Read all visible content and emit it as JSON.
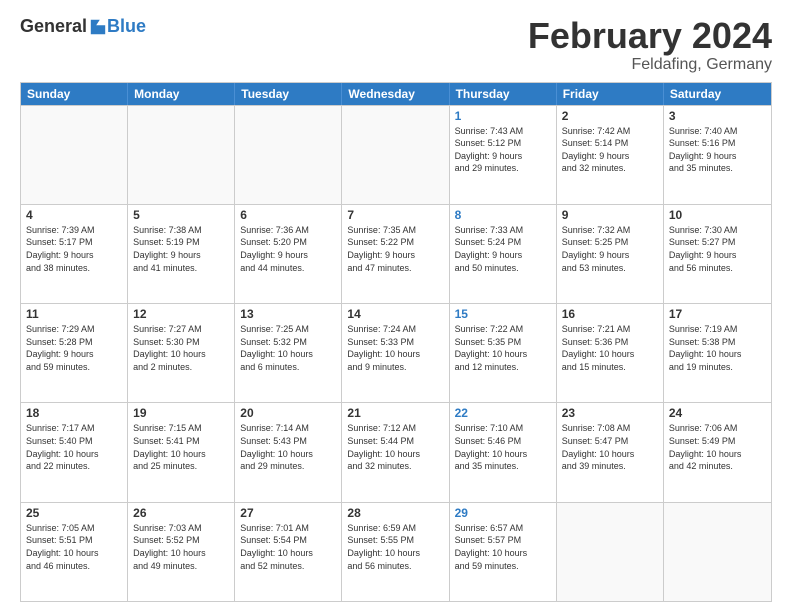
{
  "logo": {
    "general": "General",
    "blue": "Blue"
  },
  "title": "February 2024",
  "subtitle": "Feldafing, Germany",
  "days": [
    "Sunday",
    "Monday",
    "Tuesday",
    "Wednesday",
    "Thursday",
    "Friday",
    "Saturday"
  ],
  "rows": [
    [
      {
        "day": "",
        "empty": true
      },
      {
        "day": "",
        "empty": true
      },
      {
        "day": "",
        "empty": true
      },
      {
        "day": "",
        "empty": true
      },
      {
        "day": "1",
        "thursday": true,
        "info": "Sunrise: 7:43 AM\nSunset: 5:12 PM\nDaylight: 9 hours\nand 29 minutes."
      },
      {
        "day": "2",
        "info": "Sunrise: 7:42 AM\nSunset: 5:14 PM\nDaylight: 9 hours\nand 32 minutes."
      },
      {
        "day": "3",
        "info": "Sunrise: 7:40 AM\nSunset: 5:16 PM\nDaylight: 9 hours\nand 35 minutes."
      }
    ],
    [
      {
        "day": "4",
        "info": "Sunrise: 7:39 AM\nSunset: 5:17 PM\nDaylight: 9 hours\nand 38 minutes."
      },
      {
        "day": "5",
        "info": "Sunrise: 7:38 AM\nSunset: 5:19 PM\nDaylight: 9 hours\nand 41 minutes."
      },
      {
        "day": "6",
        "info": "Sunrise: 7:36 AM\nSunset: 5:20 PM\nDaylight: 9 hours\nand 44 minutes."
      },
      {
        "day": "7",
        "info": "Sunrise: 7:35 AM\nSunset: 5:22 PM\nDaylight: 9 hours\nand 47 minutes."
      },
      {
        "day": "8",
        "thursday": true,
        "info": "Sunrise: 7:33 AM\nSunset: 5:24 PM\nDaylight: 9 hours\nand 50 minutes."
      },
      {
        "day": "9",
        "info": "Sunrise: 7:32 AM\nSunset: 5:25 PM\nDaylight: 9 hours\nand 53 minutes."
      },
      {
        "day": "10",
        "info": "Sunrise: 7:30 AM\nSunset: 5:27 PM\nDaylight: 9 hours\nand 56 minutes."
      }
    ],
    [
      {
        "day": "11",
        "info": "Sunrise: 7:29 AM\nSunset: 5:28 PM\nDaylight: 9 hours\nand 59 minutes."
      },
      {
        "day": "12",
        "info": "Sunrise: 7:27 AM\nSunset: 5:30 PM\nDaylight: 10 hours\nand 2 minutes."
      },
      {
        "day": "13",
        "info": "Sunrise: 7:25 AM\nSunset: 5:32 PM\nDaylight: 10 hours\nand 6 minutes."
      },
      {
        "day": "14",
        "info": "Sunrise: 7:24 AM\nSunset: 5:33 PM\nDaylight: 10 hours\nand 9 minutes."
      },
      {
        "day": "15",
        "thursday": true,
        "info": "Sunrise: 7:22 AM\nSunset: 5:35 PM\nDaylight: 10 hours\nand 12 minutes."
      },
      {
        "day": "16",
        "info": "Sunrise: 7:21 AM\nSunset: 5:36 PM\nDaylight: 10 hours\nand 15 minutes."
      },
      {
        "day": "17",
        "info": "Sunrise: 7:19 AM\nSunset: 5:38 PM\nDaylight: 10 hours\nand 19 minutes."
      }
    ],
    [
      {
        "day": "18",
        "info": "Sunrise: 7:17 AM\nSunset: 5:40 PM\nDaylight: 10 hours\nand 22 minutes."
      },
      {
        "day": "19",
        "info": "Sunrise: 7:15 AM\nSunset: 5:41 PM\nDaylight: 10 hours\nand 25 minutes."
      },
      {
        "day": "20",
        "info": "Sunrise: 7:14 AM\nSunset: 5:43 PM\nDaylight: 10 hours\nand 29 minutes."
      },
      {
        "day": "21",
        "info": "Sunrise: 7:12 AM\nSunset: 5:44 PM\nDaylight: 10 hours\nand 32 minutes."
      },
      {
        "day": "22",
        "thursday": true,
        "info": "Sunrise: 7:10 AM\nSunset: 5:46 PM\nDaylight: 10 hours\nand 35 minutes."
      },
      {
        "day": "23",
        "info": "Sunrise: 7:08 AM\nSunset: 5:47 PM\nDaylight: 10 hours\nand 39 minutes."
      },
      {
        "day": "24",
        "info": "Sunrise: 7:06 AM\nSunset: 5:49 PM\nDaylight: 10 hours\nand 42 minutes."
      }
    ],
    [
      {
        "day": "25",
        "info": "Sunrise: 7:05 AM\nSunset: 5:51 PM\nDaylight: 10 hours\nand 46 minutes."
      },
      {
        "day": "26",
        "info": "Sunrise: 7:03 AM\nSunset: 5:52 PM\nDaylight: 10 hours\nand 49 minutes."
      },
      {
        "day": "27",
        "info": "Sunrise: 7:01 AM\nSunset: 5:54 PM\nDaylight: 10 hours\nand 52 minutes."
      },
      {
        "day": "28",
        "info": "Sunrise: 6:59 AM\nSunset: 5:55 PM\nDaylight: 10 hours\nand 56 minutes."
      },
      {
        "day": "29",
        "thursday": true,
        "info": "Sunrise: 6:57 AM\nSunset: 5:57 PM\nDaylight: 10 hours\nand 59 minutes."
      },
      {
        "day": "",
        "empty": true
      },
      {
        "day": "",
        "empty": true
      }
    ]
  ]
}
